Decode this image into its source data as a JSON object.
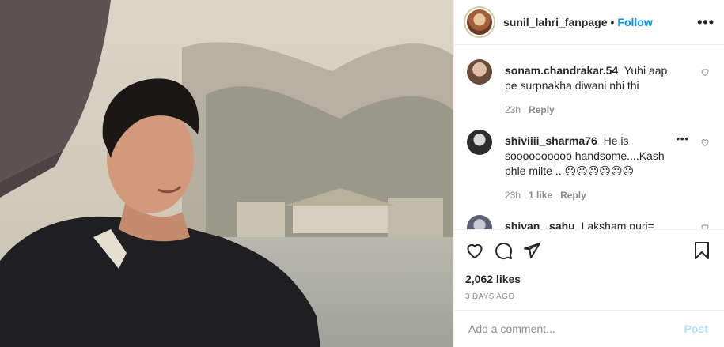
{
  "post": {
    "username": "sunil_lahri_fanpage",
    "separator": "•",
    "follow_label": "Follow",
    "more_icon": "•••",
    "photo_icon": "photo-man-smiling-by-lake"
  },
  "comments": [
    {
      "username": "sonam.chandrakar.54",
      "text": "Yuhi aap pe surpnakha diwani nhi thi",
      "time": "23h",
      "likes": "",
      "reply_label": "Reply",
      "avatar_color": "#c9a58a"
    },
    {
      "username": "shiviiii_sharma76",
      "text": "He is soooooooooo handsome....Kash phle milte ...☹☹☹☹☹☹",
      "time": "23h",
      "likes": "1 like",
      "reply_label": "Reply",
      "more_icon": "•••",
      "avatar_color": "#3c3c3c"
    },
    {
      "username": "shivan_ sahu",
      "text": "Laksham puri=",
      "time": "",
      "likes": "",
      "reply_label": "",
      "avatar_color": "#8a8f9e"
    }
  ],
  "actions": {
    "like_icon": "heart-icon",
    "comment_icon": "comment-icon",
    "share_icon": "paper-plane-icon",
    "save_icon": "bookmark-icon",
    "likes_count": "2,062 likes",
    "time_ago": "3 DAYS AGO"
  },
  "add_comment": {
    "placeholder": "Add a comment...",
    "post_label": "Post",
    "post_color": "#b2dffc"
  },
  "colors": {
    "accent": "#0095f6",
    "text": "#262626",
    "muted": "#8e8e8e",
    "border": "#efefef"
  }
}
